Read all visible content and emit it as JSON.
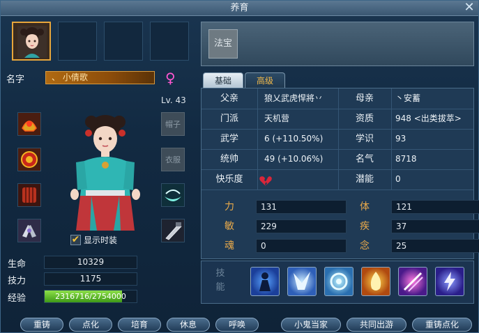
{
  "window": {
    "title": "养育",
    "close_label": "✕"
  },
  "character": {
    "name_label": "名字",
    "name": "、 小倩歌",
    "gender_symbol": "♀",
    "level": "Lv. 43",
    "fashion_label": "显示时装",
    "fashion_checked": "✔"
  },
  "equipment": {
    "hat_empty": "帽子",
    "clothes_empty": "衣服"
  },
  "stats": {
    "hp_label": "生命",
    "hp": "10329",
    "skill_label": "技力",
    "skill": "1175",
    "exp_label": "经验",
    "exp": "2316716/2754000",
    "exp_progress": 0.841
  },
  "fabao": {
    "label": "法宝"
  },
  "tabs": {
    "basic": "基础",
    "advanced": "高级"
  },
  "info": [
    {
      "label": "父亲",
      "value": "狼乂武虎悍將丷",
      "label2": "母亲",
      "value2": "丶安蓄"
    },
    {
      "label": "门派",
      "value": "天机营",
      "label2": "资质",
      "value2": "948 <出类拔萃>"
    },
    {
      "label": "武学",
      "value": "6 (+110.50%)",
      "label2": "学识",
      "value2": "93"
    },
    {
      "label": "统帅",
      "value": "49 (+10.06%)",
      "label2": "名气",
      "value2": "8718"
    },
    {
      "label": "快乐度",
      "value": "",
      "label2": "潜能",
      "value2": "0"
    }
  ],
  "attributes": [
    {
      "label": "力",
      "value": "131",
      "label2": "体",
      "value2": "121"
    },
    {
      "label": "敏",
      "value": "229",
      "label2": "疾",
      "value2": "37"
    },
    {
      "label": "魂",
      "value": "0",
      "label2": "念",
      "value2": "25"
    }
  ],
  "skills": {
    "label": "技能"
  },
  "buttons": {
    "recast": "重铸",
    "transform": "点化",
    "train": "培育",
    "rest": "休息",
    "summon": "呼唤",
    "housekeeper": "小鬼当家",
    "travel": "共同出游",
    "recast_transform": "重铸点化"
  },
  "colors": {
    "accent": "#e7a63b",
    "gender": "#ff57d1",
    "exp_fill": "#5cc020",
    "attr_label": "#e8a94a"
  }
}
